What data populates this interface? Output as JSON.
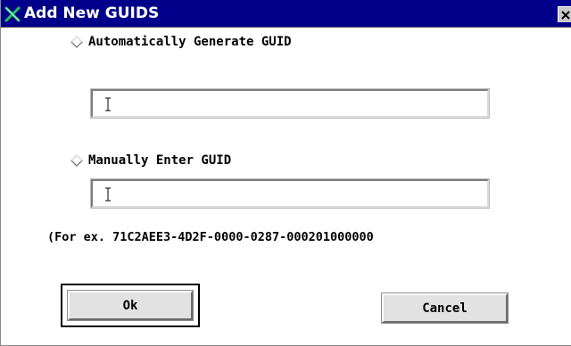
{
  "window": {
    "title": "Add New GUIDS",
    "title_icon": "x-logo-icon",
    "close_icon": "close-icon",
    "colors": {
      "titlebar": "#00008b",
      "title_text": "#ffffff",
      "logo": "#22c55e"
    }
  },
  "options": {
    "auto": {
      "label": "Automatically Generate GUID",
      "selected": false,
      "field_value": ""
    },
    "manual": {
      "label": "Manually Enter GUID",
      "selected": false,
      "field_value": ""
    }
  },
  "example_text": "(For ex. 71C2AEE3-4D2F-0000-0287-000201000000",
  "buttons": {
    "ok_label": "Ok",
    "cancel_label": "Cancel"
  }
}
